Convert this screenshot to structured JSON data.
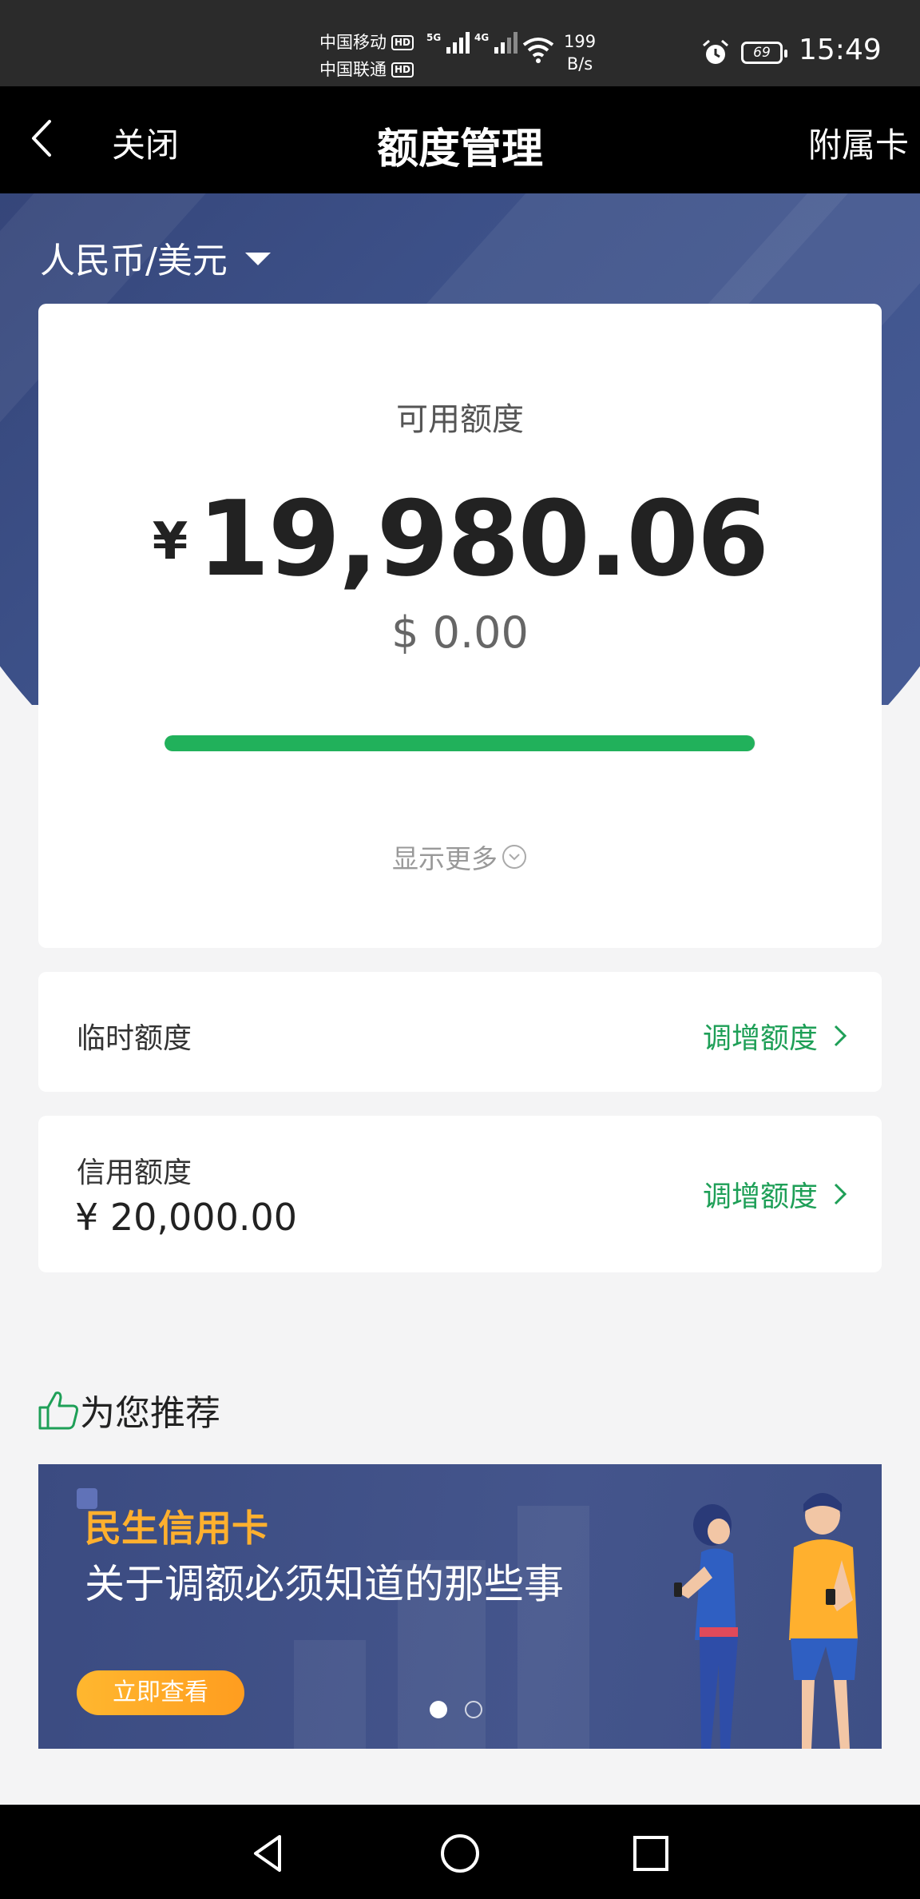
{
  "status_bar": {
    "carrier1": "中国移动",
    "carrier2": "中国联通",
    "hd_label": "HD",
    "net1": "5G",
    "net2": "4G",
    "speed_value": "199",
    "speed_unit": "B/s",
    "battery": "69",
    "time": "15:49"
  },
  "navbar": {
    "close_label": "关闭",
    "title": "额度管理",
    "supplementary_card": "附属卡"
  },
  "currency": {
    "selected": "人民币/美元"
  },
  "available": {
    "label": "可用额度",
    "currency_symbol": "¥",
    "amount": "19,980.06",
    "usd_amount": "$ 0.00",
    "progress_fraction": 0.999,
    "show_more": "显示更多"
  },
  "temporary_quota": {
    "label": "临时额度",
    "action": "调增额度"
  },
  "credit_quota": {
    "label": "信用额度",
    "amount": "¥ 20,000.00",
    "action": "调增额度"
  },
  "recommend": {
    "title": "为您推荐",
    "banner": {
      "brand": "民生信用卡",
      "headline": "关于调额必须知道的那些事",
      "button": "立即查看",
      "slides": 2,
      "active_slide": 1
    }
  },
  "colors": {
    "accent_green": "#21b15b",
    "hero_blue": "#3d5189",
    "banner_orange": "#ffb02e"
  }
}
